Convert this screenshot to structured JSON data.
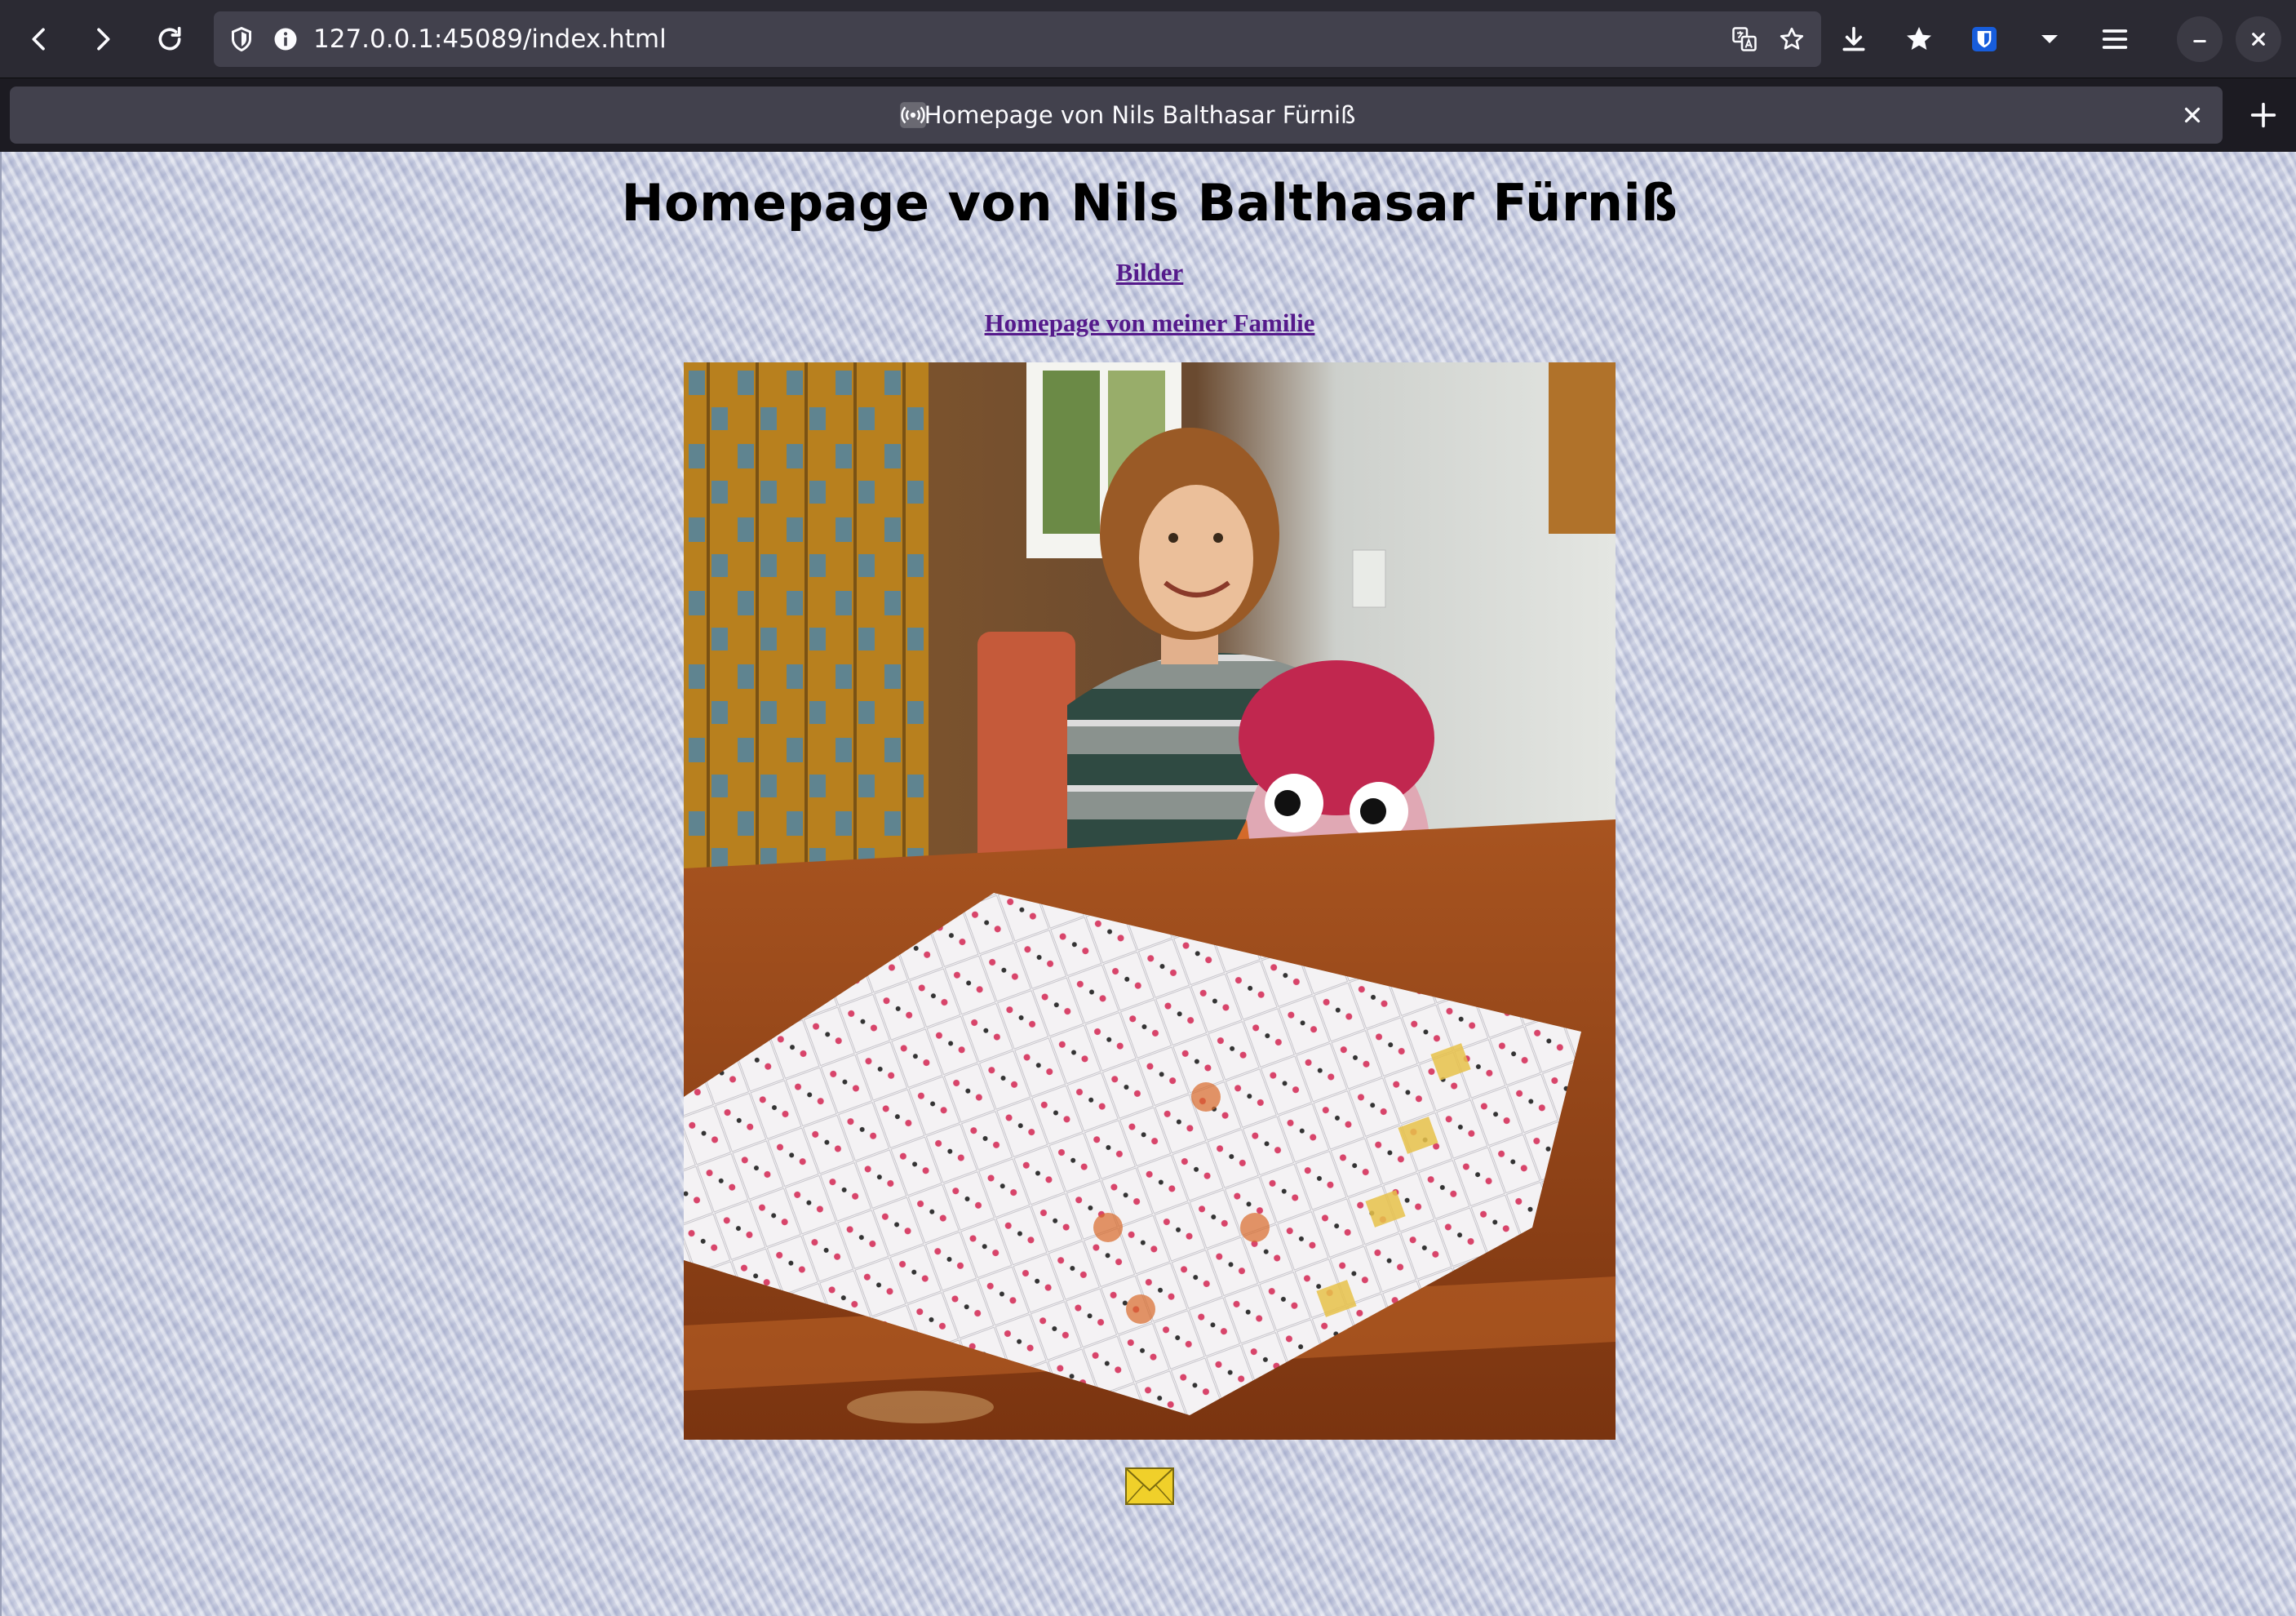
{
  "browser": {
    "url": "127.0.0.1:45089/index.html",
    "tab_title": "Homepage von Nils Balthasar Fürniß"
  },
  "page": {
    "title": "Homepage von Nils Balthasar Fürniß",
    "links": [
      {
        "label": "Bilder"
      },
      {
        "label": "Homepage von meiner Familie"
      }
    ],
    "photo_description_icon": "photo",
    "mail_icon": "envelope-icon"
  },
  "colors": {
    "link": "#551a8b",
    "browser_chrome": "#2b2a33",
    "urlbar": "#42414d"
  }
}
